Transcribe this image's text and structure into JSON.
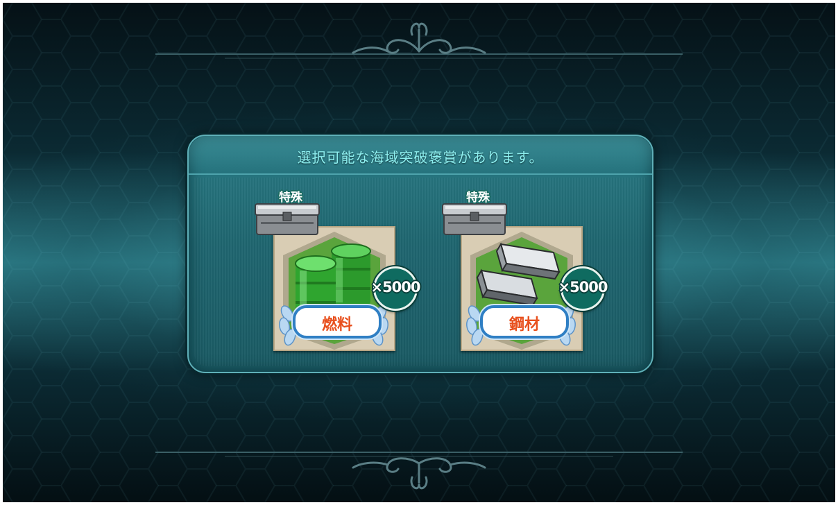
{
  "screen": {
    "title": "選択可能な海域突破褒賞があります。"
  },
  "rewards": [
    {
      "badge": "特殊",
      "name": "燃料",
      "quantity": "×5000",
      "item_icon": "fuel-drums-icon",
      "chest_icon": "metal-chest-icon"
    },
    {
      "badge": "特殊",
      "name": "鋼材",
      "quantity": "×5000",
      "item_icon": "steel-ingots-icon",
      "chest_icon": "metal-chest-icon"
    }
  ],
  "colors": {
    "title_text": "#8ef0f0",
    "panel": "#1f6670",
    "reward_name": "#e8501e",
    "quantity_badge": "#0f6b60",
    "name_plate_border": "#2f7fc4"
  }
}
